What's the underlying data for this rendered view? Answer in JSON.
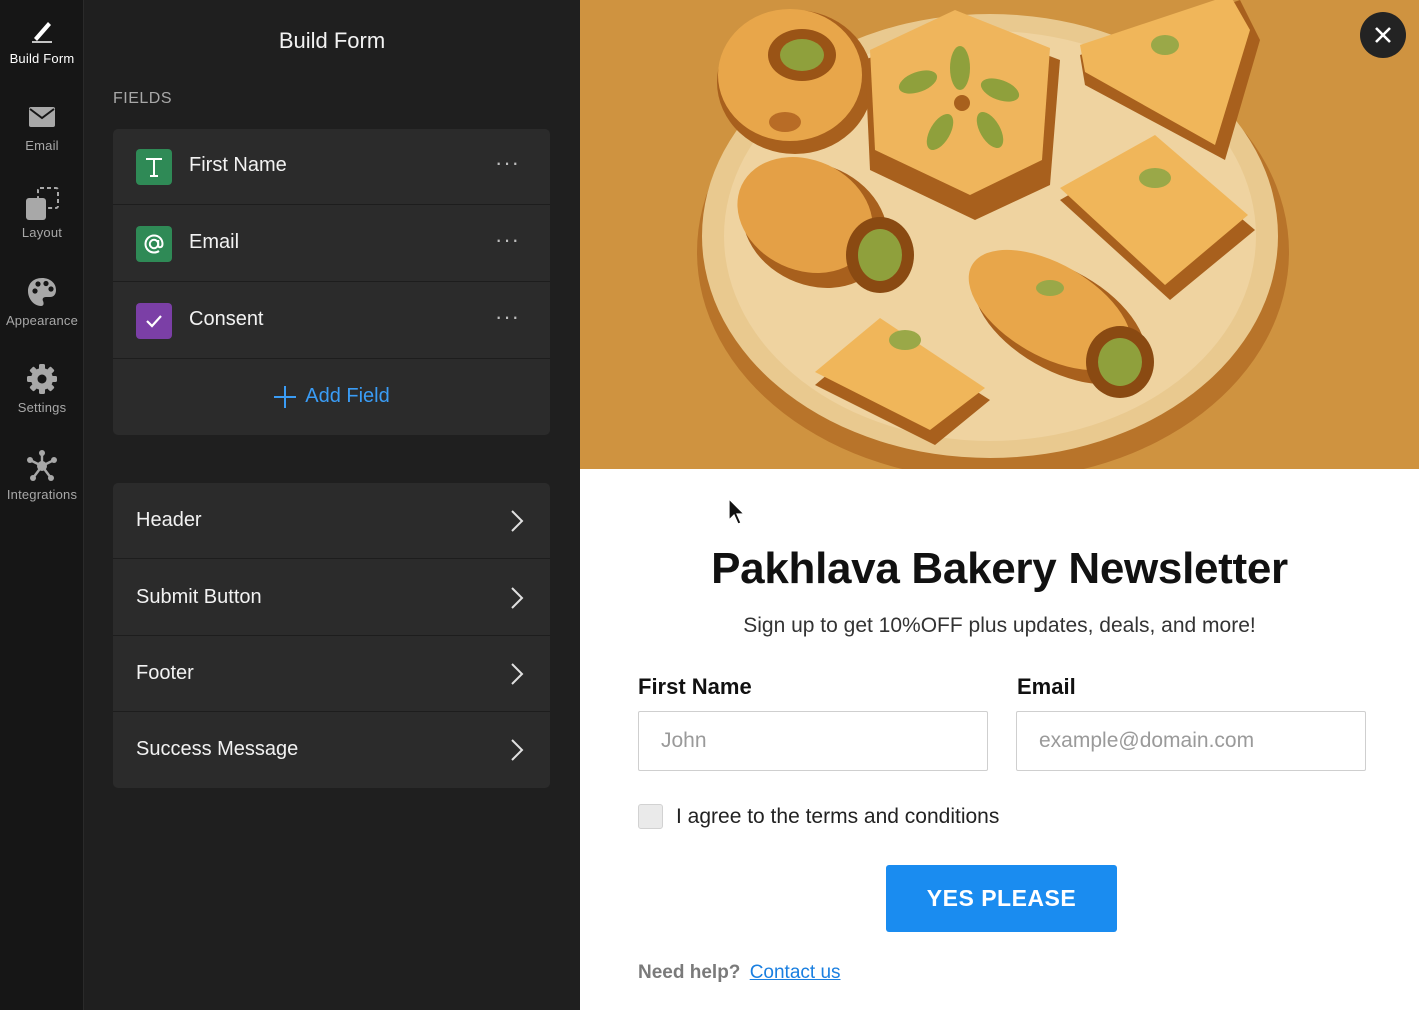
{
  "sidebar": {
    "items": [
      {
        "label": "Build Form",
        "icon": "pencil-icon",
        "active": true
      },
      {
        "label": "Email",
        "icon": "envelope-icon"
      },
      {
        "label": "Layout",
        "icon": "layout-icon"
      },
      {
        "label": "Appearance",
        "icon": "palette-icon"
      },
      {
        "label": "Settings",
        "icon": "gear-icon"
      },
      {
        "label": "Integrations",
        "icon": "integrations-icon"
      }
    ]
  },
  "panel": {
    "title": "Build Form",
    "fields_label": "FIELDS",
    "fields": [
      {
        "label": "First Name",
        "icon": "text-field-icon",
        "color": "#2f8a56",
        "more": "···"
      },
      {
        "label": "Email",
        "icon": "at-sign-icon",
        "color": "#2f8a56",
        "more": "···"
      },
      {
        "label": "Consent",
        "icon": "checkbox-icon",
        "color": "#7b3fa6",
        "more": "···"
      }
    ],
    "add_field_label": "Add Field",
    "sections": [
      {
        "label": "Header"
      },
      {
        "label": "Submit Button"
      },
      {
        "label": "Footer"
      },
      {
        "label": "Success Message"
      }
    ]
  },
  "preview": {
    "title": "Pakhlava Bakery Newsletter",
    "subtitle": "Sign up to get 10%OFF plus updates, deals, and more!",
    "first_name_label": "First Name",
    "first_name_placeholder": "John",
    "email_label": "Email",
    "email_placeholder": "example@domain.com",
    "consent_label": "I agree to the terms and conditions",
    "submit_label": "YES PLEASE",
    "help_text": "Need help?",
    "help_link": "Contact us"
  },
  "colors": {
    "accent": "#1a8cf0",
    "add_field": "#3a9cf5",
    "hero_background": "#cf9340"
  }
}
